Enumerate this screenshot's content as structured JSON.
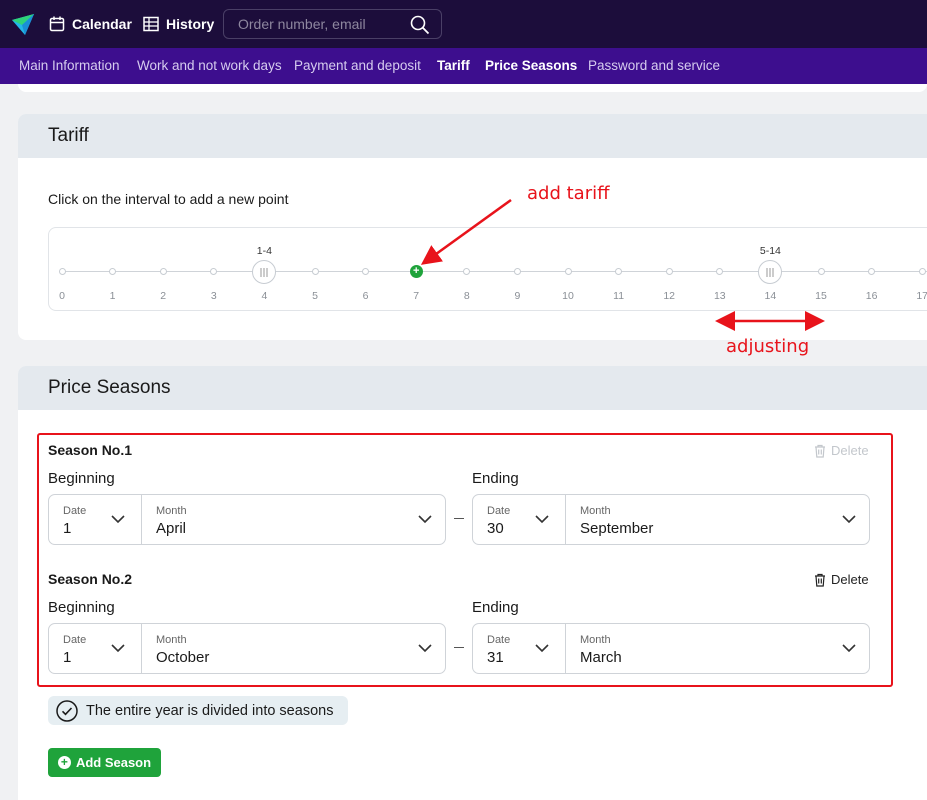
{
  "topbar": {
    "calendar_label": "Calendar",
    "history_label": "History",
    "search_placeholder": "Order number, email"
  },
  "subnav": {
    "items": [
      "Main Information",
      "Work and not work days",
      "Payment and deposit",
      "Tariff",
      "Price Seasons",
      "Password and service"
    ],
    "active": [
      "Tariff",
      "Price Seasons"
    ]
  },
  "tariff": {
    "title": "Tariff",
    "hint": "Click on the interval to add a new point",
    "ticks": [
      "0",
      "1",
      "2",
      "3",
      "4",
      "5",
      "6",
      "7",
      "8",
      "9",
      "10",
      "11",
      "12",
      "13",
      "14",
      "15",
      "16",
      "17"
    ],
    "handles": [
      {
        "label": "1-4",
        "at": 4
      },
      {
        "label": "5-14",
        "at": 14
      }
    ],
    "new_point_at": 7
  },
  "annotations": {
    "add_tariff": "add tariff",
    "adjusting": "adjusting"
  },
  "seasons": {
    "title": "Price Seasons",
    "delete_label": "Delete",
    "beginning_label": "Beginning",
    "ending_label": "Ending",
    "date_label": "Date",
    "month_label": "Month",
    "list": [
      {
        "title": "Season No.1",
        "begin_date": "1",
        "begin_month": "April",
        "end_date": "30",
        "end_month": "September",
        "delete_enabled": false
      },
      {
        "title": "Season No.2",
        "begin_date": "1",
        "begin_month": "October",
        "end_date": "31",
        "end_month": "March",
        "delete_enabled": true
      }
    ],
    "notice": "The entire year is divided into seasons",
    "add_button": "Add Season"
  },
  "colors": {
    "topbar": "#1c0d3b",
    "subnav": "#3d0e8e",
    "accent_green": "#1fa33b",
    "annotation_red": "#e8131b"
  }
}
